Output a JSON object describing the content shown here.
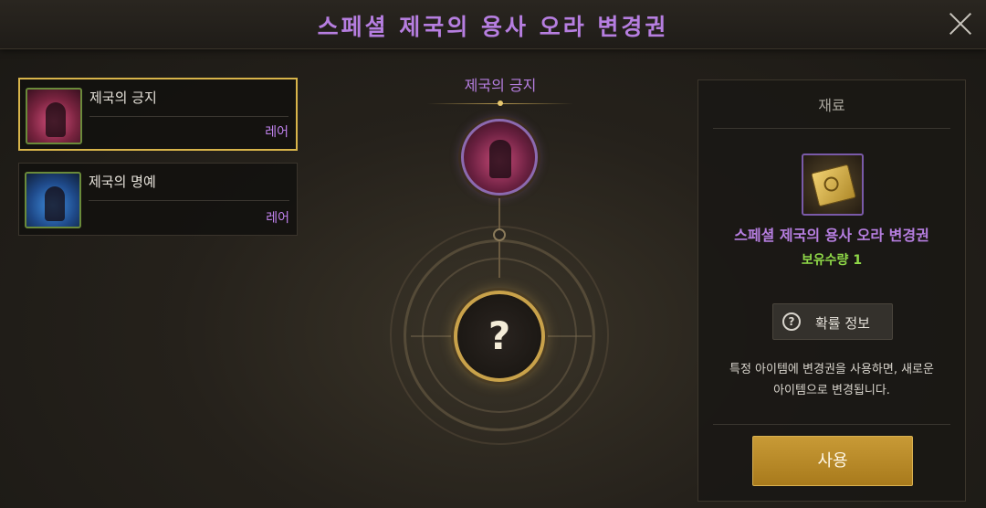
{
  "header": {
    "title": "스페셜 제국의 용사 오라 변경권",
    "close_icon": "close-icon"
  },
  "item_list": [
    {
      "name": "제국의 긍지",
      "grade": "레어",
      "color": "#d8507e",
      "selected": true
    },
    {
      "name": "제국의 명예",
      "grade": "레어",
      "color": "#3f8fe0",
      "selected": false
    }
  ],
  "center": {
    "selected_name": "제국의 긍지",
    "result_symbol": "?"
  },
  "panel": {
    "header": "재료",
    "material_name": "스페셜 제국의 용사 오라 변경권",
    "material_count": "보유수량 1",
    "prob_button_label": "확률 정보",
    "prob_icon_symbol": "?",
    "description_line1": "특정 아이템에 변경권을 사용하면, 새로운",
    "description_line2": "아이템으로 변경됩니다.",
    "use_button_label": "사용"
  },
  "colors": {
    "accent_purple": "#b67ee0",
    "count_green": "#8fd848",
    "gold": "#c89a36",
    "selected_border": "#d8b44a"
  }
}
